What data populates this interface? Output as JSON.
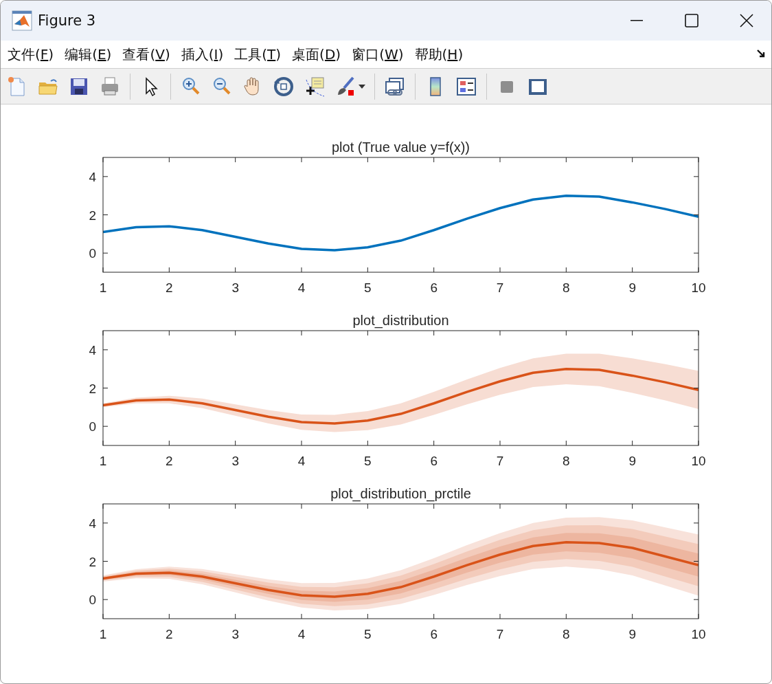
{
  "window": {
    "title": "Figure 3"
  },
  "menu": [
    {
      "label": "文件(F)"
    },
    {
      "label": "编辑(E)"
    },
    {
      "label": "查看(V)"
    },
    {
      "label": "插入(I)"
    },
    {
      "label": "工具(T)"
    },
    {
      "label": "桌面(D)"
    },
    {
      "label": "窗口(W)"
    },
    {
      "label": "帮助(H)"
    }
  ],
  "charts": [
    {
      "kind": "plain",
      "chart_data": {
        "type": "line",
        "title": "plot (True value y=f(x))",
        "xlim": [
          1,
          10
        ],
        "ylim": [
          -1,
          5
        ],
        "xticks": [
          1,
          2,
          3,
          4,
          5,
          6,
          7,
          8,
          9,
          10
        ],
        "yticks": [
          0,
          2,
          4
        ],
        "x": [
          1,
          1.5,
          2,
          2.5,
          3,
          3.5,
          4,
          4.5,
          5,
          5.5,
          6,
          6.5,
          7,
          7.5,
          8,
          8.5,
          9,
          9.5,
          10
        ],
        "series": [
          {
            "color": "#0072bd",
            "values": [
              1.1,
              1.35,
              1.4,
              1.2,
              0.85,
              0.5,
              0.22,
              0.15,
              0.3,
              0.65,
              1.2,
              1.8,
              2.35,
              2.8,
              3.0,
              2.95,
              2.65,
              2.3,
              1.9
            ]
          }
        ]
      }
    },
    {
      "kind": "band",
      "chart_data": {
        "type": "line",
        "title": "plot_distribution",
        "xlim": [
          1,
          10
        ],
        "ylim": [
          -1,
          5
        ],
        "xticks": [
          1,
          2,
          3,
          4,
          5,
          6,
          7,
          8,
          9,
          10
        ],
        "yticks": [
          0,
          2,
          4
        ],
        "x": [
          1,
          1.5,
          2,
          2.5,
          3,
          3.5,
          4,
          4.5,
          5,
          5.5,
          6,
          6.5,
          7,
          7.5,
          8,
          8.5,
          9,
          9.5,
          10
        ],
        "series": [
          {
            "color": "#d95319",
            "values": [
              1.1,
              1.35,
              1.4,
              1.2,
              0.85,
              0.5,
              0.22,
              0.15,
              0.3,
              0.65,
              1.2,
              1.8,
              2.35,
              2.8,
              3.0,
              2.95,
              2.65,
              2.3,
              1.9
            ]
          }
        ]
      }
    },
    {
      "kind": "percentile",
      "chart_data": {
        "type": "line",
        "title": "plot_distribution_prctile",
        "xlim": [
          1,
          10
        ],
        "ylim": [
          -1,
          5
        ],
        "xticks": [
          1,
          2,
          3,
          4,
          5,
          6,
          7,
          8,
          9,
          10
        ],
        "yticks": [
          0,
          2,
          4
        ],
        "x": [
          1,
          1.5,
          2,
          2.5,
          3,
          3.5,
          4,
          4.5,
          5,
          5.5,
          6,
          6.5,
          7,
          7.5,
          8,
          8.5,
          9,
          9.5,
          10
        ],
        "series": [
          {
            "color": "#d95319",
            "values": [
              1.1,
              1.35,
              1.4,
              1.2,
              0.85,
              0.5,
              0.22,
              0.15,
              0.3,
              0.65,
              1.2,
              1.8,
              2.35,
              2.8,
              3.0,
              2.95,
              2.7,
              2.25,
              1.8
            ]
          }
        ]
      }
    }
  ]
}
